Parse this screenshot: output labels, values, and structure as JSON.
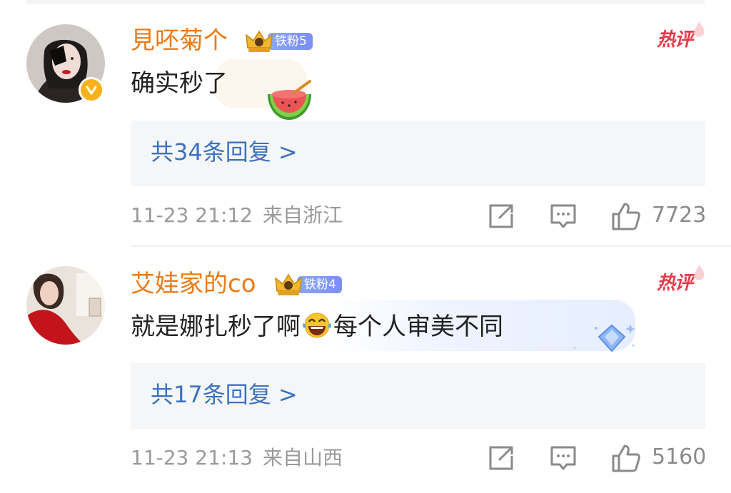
{
  "comments": [
    {
      "username": "見呸菊个",
      "badge_label": "铁粉5",
      "hot_label": "热评",
      "text": "确实秒了",
      "reply_label": "共34条回复 >",
      "time": "11-23 21:12",
      "location": "来自浙江",
      "likes": "7723"
    },
    {
      "username": "艾娃家的co",
      "badge_label": "铁粉4",
      "hot_label": "热评",
      "text_before_emoji": "就是娜扎秒了啊",
      "text_after_emoji": "每个人审美不同",
      "reply_label": "共17条回复 >",
      "time": "11-23 21:13",
      "location": "来自山西",
      "likes": "5160"
    }
  ],
  "colors": {
    "username": "#ee7a14",
    "hot_tag": "#e63b4a",
    "reply_link": "#3c72c0",
    "badge": "#7c8ef5",
    "meta_text": "#9a9a9a"
  },
  "icons": [
    "verified-badge-icon",
    "crown-icon",
    "flame-icon",
    "watermelon-sticker-icon",
    "laughing-emoji-icon",
    "diamond-sticker-icon",
    "share-icon",
    "comment-icon",
    "like-icon"
  ]
}
